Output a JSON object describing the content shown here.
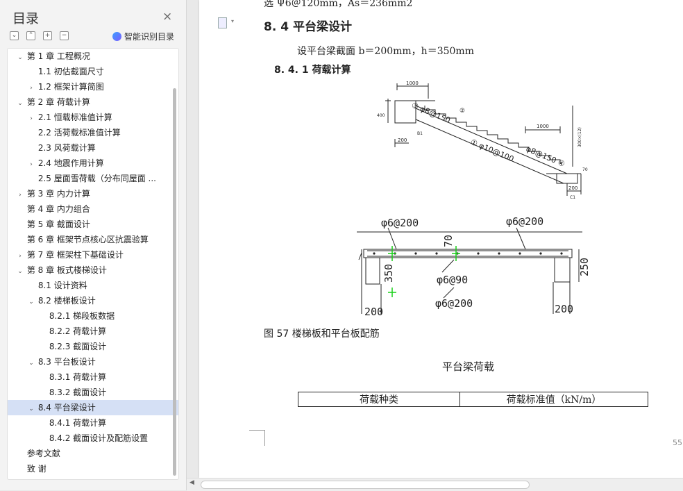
{
  "sidebar": {
    "title": "目录",
    "close_icon": "×",
    "tool_buttons": [
      "⌄",
      "⌃",
      "+",
      "−"
    ],
    "smart_toc_label": "智能识别目录",
    "items": [
      {
        "caret": "⌄",
        "label": "第 1 章    工程概况"
      },
      {
        "caret": "",
        "label": "1.1  初估截面尺寸"
      },
      {
        "caret": "›",
        "label": "1.2  框架计算简图"
      },
      {
        "caret": "⌄",
        "label": "第 2 章    荷载计算"
      },
      {
        "caret": "›",
        "label": "2.1  恒载标准值计算"
      },
      {
        "caret": "",
        "label": "2.2  活荷载标准值计算"
      },
      {
        "caret": "",
        "label": "2.3  风荷载计算"
      },
      {
        "caret": "›",
        "label": "2.4 地震作用计算"
      },
      {
        "caret": "",
        "label": "2.5  屋面雪荷载（分布同屋面 ..."
      },
      {
        "caret": "›",
        "label": "第 3 章    内力计算"
      },
      {
        "caret": "",
        "label": "第 4 章    内力组合"
      },
      {
        "caret": "",
        "label": "第 5 章    截面设计"
      },
      {
        "caret": "",
        "label": "第 6 章    框架节点核心区抗震验算"
      },
      {
        "caret": "›",
        "label": "第 7 章    框架柱下基础设计"
      },
      {
        "caret": "⌄",
        "label": "第 8 章    板式楼梯设计"
      },
      {
        "caret": "",
        "label": "8.1 设计资料"
      },
      {
        "caret": "⌄",
        "label": "8.2 楼梯板设计"
      },
      {
        "caret": "",
        "label": "8.2.1 梯段板数据"
      },
      {
        "caret": "",
        "label": "8.2.2 荷载计算"
      },
      {
        "caret": "",
        "label": "8.2.3 截面设计"
      },
      {
        "caret": "⌄",
        "label": "8.3 平台板设计"
      },
      {
        "caret": "",
        "label": "8.3.1 荷载计算"
      },
      {
        "caret": "",
        "label": "8.3.2 截面设计"
      },
      {
        "caret": "⌄",
        "label": "8.4 平台梁设计"
      },
      {
        "caret": "",
        "label": "8.4.1 荷载计算"
      },
      {
        "caret": "",
        "label": "8.4.2 截面设计及配筋设置"
      },
      {
        "caret": "",
        "label": "参考文献"
      },
      {
        "caret": "",
        "label": "致    谢"
      }
    ]
  },
  "doc": {
    "top_cut": "选 Ψ6＠120mm，As＝236mm2",
    "heading_84": "8. 4 平台梁设计",
    "beam_section": "设平台梁截面     b＝200mm，h＝350mm",
    "heading_841": "8. 4. 1 荷载计算",
    "fig1_labels": {
      "dim_top": "1000",
      "dim_right": "1000",
      "dim_200a": "200",
      "dim_200b": "200",
      "dim_400": "400",
      "rebar_top": "③ φ8@150",
      "rebar_mid": "① φ10@100",
      "rebar_low": "φ8@150 ④",
      "mark2": "②",
      "b1": "B1",
      "c1": "C1",
      "tread_total": "300×(12)",
      "dim_70": "70"
    },
    "fig2_labels": {
      "rebar_left": "φ6@200",
      "rebar_right": "φ6@200",
      "rebar_mid": "φ6@90",
      "rebar_bottom": "φ6@200",
      "dim_70": "70",
      "dim_350": "350",
      "dim_250": "250",
      "dim_200a": "200",
      "dim_200b": "200"
    },
    "figure_caption": "图 57  楼梯板和平台板配筋",
    "table_title": "平台梁荷载",
    "table_headers": [
      "荷载种类",
      "荷载标准值（kN/m）"
    ],
    "page_number": "55"
  }
}
